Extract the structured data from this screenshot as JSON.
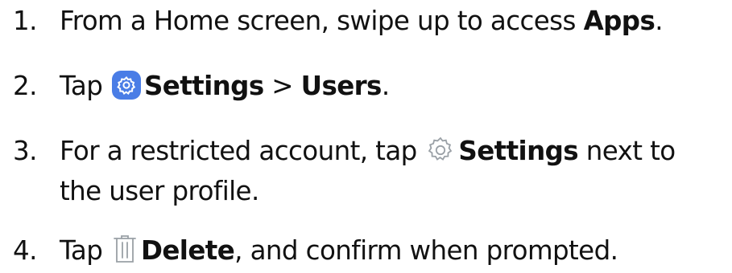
{
  "steps": [
    {
      "number": "1.",
      "text": "From a Home screen, swipe up to access ",
      "bold": "Apps",
      "end": "."
    },
    {
      "number": "2.",
      "text": "Tap ",
      "icon": "settings-app-icon",
      "bold": "Settings",
      "separator": " > ",
      "bold2": "Users",
      "end": "."
    },
    {
      "number": "3.",
      "text": "For a restricted account, tap ",
      "icon": "gear-outline-icon",
      "bold": "Settings",
      "after": " next to",
      "line2": "the user profile."
    },
    {
      "number": "4.",
      "text": "Tap ",
      "icon": "trash-icon",
      "bold": "Delete",
      "after": ", and confirm when prompted."
    }
  ],
  "colors": {
    "settings_icon_bg": "#4a7de6",
    "icon_stroke": "#9aa0a6",
    "text": "#111111"
  }
}
